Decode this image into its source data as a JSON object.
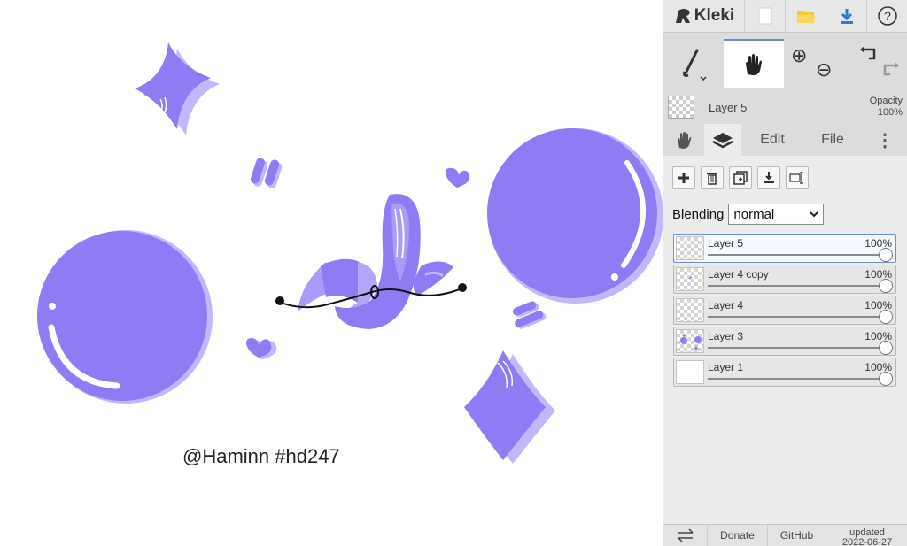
{
  "app": {
    "name": "Kleki"
  },
  "canvas": {
    "signature": "@Haminn #hd247",
    "colors": {
      "main": "#8e7cf5",
      "shadow": "#c1b8fb",
      "highlight": "#ffffff",
      "ink": "#111111"
    }
  },
  "topbar": {
    "new_icon": "new-file-icon",
    "open_icon": "folder-icon",
    "download_icon": "download-icon",
    "help_glyph": "?"
  },
  "tools": {
    "brush": "brush-icon",
    "hand": "hand-icon",
    "zoom_in": "⊕",
    "zoom_out": "⊖",
    "undo": "undo-icon",
    "redo": "redo-icon"
  },
  "current_layer": {
    "name": "Layer 5",
    "opacity_label": "Opacity",
    "opacity_value": "100%"
  },
  "tabs": {
    "edit": "Edit",
    "file": "File",
    "more": "⋮"
  },
  "layers_panel": {
    "blending_label": "Blending",
    "blending_value": "normal",
    "layers": [
      {
        "name": "Layer 5",
        "opacity": "100%",
        "active": true
      },
      {
        "name": "Layer 4 copy",
        "opacity": "100%",
        "active": false
      },
      {
        "name": "Layer 4",
        "opacity": "100%",
        "active": false
      },
      {
        "name": "Layer 3",
        "opacity": "100%",
        "active": false
      },
      {
        "name": "Layer 1",
        "opacity": "100%",
        "active": false
      }
    ]
  },
  "bottombar": {
    "donate": "Donate",
    "github": "GitHub",
    "updated_label": "updated",
    "updated_date": "2022-06-27"
  }
}
